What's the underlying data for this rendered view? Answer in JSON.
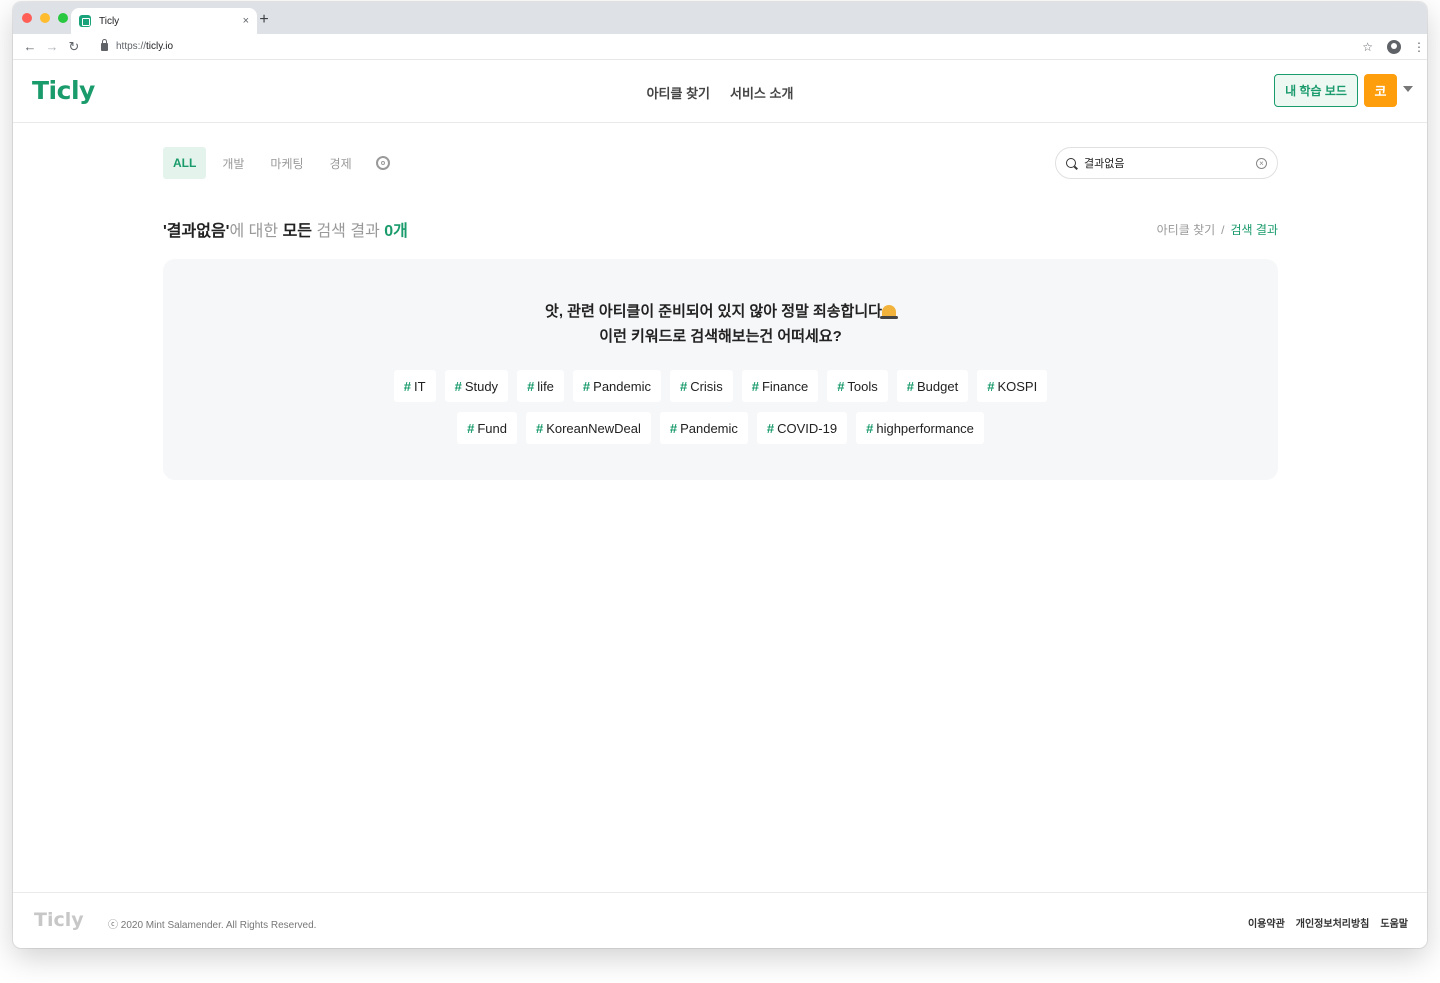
{
  "browser": {
    "tab_title": "Ticly",
    "close_glyph": "×",
    "newtab_glyph": "+",
    "back_glyph": "←",
    "forward_glyph": "→",
    "reload_glyph": "↻",
    "url_scheme": "https://",
    "url_host": "ticly.io",
    "star_glyph": "☆",
    "menu_glyph": "⋮"
  },
  "header": {
    "logo": "Ticly",
    "nav": [
      "아티클 찾기",
      "서비스 소개"
    ],
    "dashboard_label": "내 학습 보드",
    "avatar_label": "코"
  },
  "filters": {
    "tabs": [
      "ALL",
      "개발",
      "마케팅",
      "경제"
    ],
    "active_tab": "ALL",
    "search_value": "결과없음",
    "clear_glyph": "×"
  },
  "results": {
    "keyword": "'결과없음'",
    "text_about": "에 대한 ",
    "text_all": "모든",
    "text_results": " 검색 결과 ",
    "count": "0개",
    "breadcrumb_parent": "아티클 찾기",
    "breadcrumb_sep": "/",
    "breadcrumb_current": "검색 결과"
  },
  "empty_state": {
    "line1": "앗, 관련 아티클이 준비되어 있지 않아 정말 죄송합니다",
    "line2": "이런 키워드로 검색해보는건 어떠세요?",
    "hash": "#",
    "tags_row1": [
      "IT",
      "Study",
      "life",
      "Pandemic",
      "Crisis",
      "Finance",
      "Tools",
      "Budget",
      "KOSPI"
    ],
    "tags_row2": [
      "Fund",
      "KoreanNewDeal",
      "Pandemic",
      "COVID-19",
      "highperformance"
    ]
  },
  "footer": {
    "logo": "Ticly",
    "copyright": "ⓒ 2020 Mint Salamender. All Rights Reserved.",
    "links": [
      "이용약관",
      "개인정보처리방침",
      "도움말"
    ]
  },
  "colors": {
    "brand": "#1a9b6c",
    "avatar": "#ff9e0d",
    "panel": "#f6f7f9"
  }
}
